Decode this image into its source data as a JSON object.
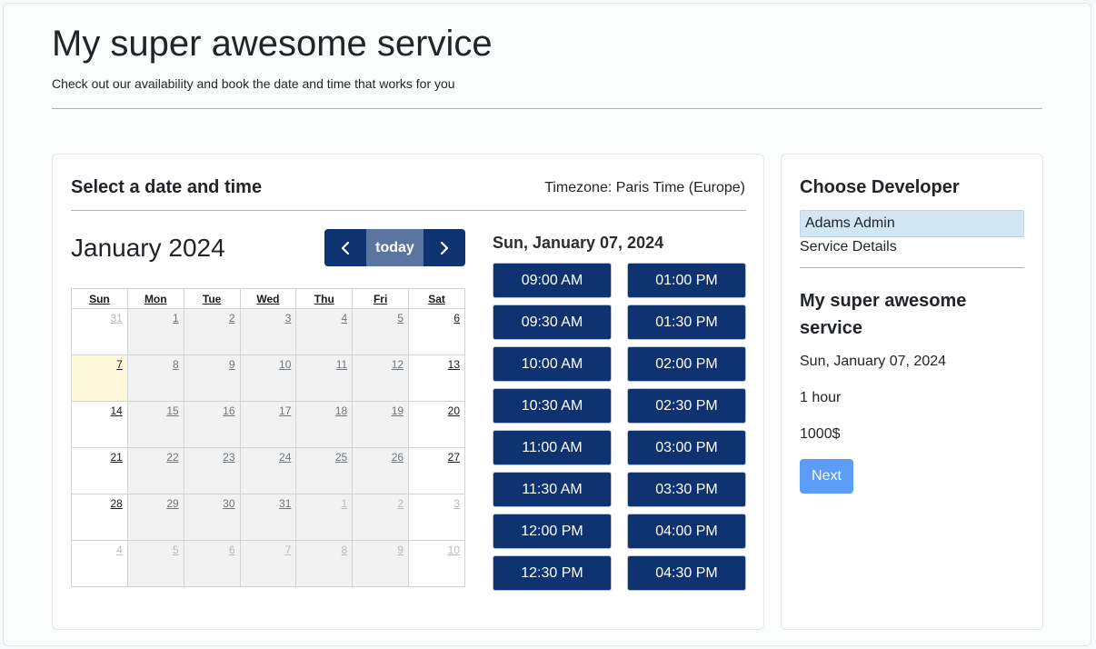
{
  "header": {
    "title": "My super awesome service",
    "subtitle": "Check out our availability and book the date and time that works for you"
  },
  "booking": {
    "heading": "Select a date and time",
    "timezone": "Timezone: Paris Time (Europe)",
    "calendar": {
      "month_title": "January 2024",
      "today_label": "today",
      "prev_icon": "chevron-left-icon",
      "next_icon": "chevron-right-icon",
      "weekdays": [
        "Sun",
        "Mon",
        "Tue",
        "Wed",
        "Thu",
        "Fri",
        "Sat"
      ],
      "weeks": [
        [
          "31",
          "1",
          "2",
          "3",
          "4",
          "5",
          "6"
        ],
        [
          "7",
          "8",
          "9",
          "10",
          "11",
          "12",
          "13"
        ],
        [
          "14",
          "15",
          "16",
          "17",
          "18",
          "19",
          "20"
        ],
        [
          "21",
          "22",
          "23",
          "24",
          "25",
          "26",
          "27"
        ],
        [
          "28",
          "29",
          "30",
          "31",
          "1",
          "2",
          "3"
        ],
        [
          "4",
          "5",
          "6",
          "7",
          "8",
          "9",
          "10"
        ]
      ]
    },
    "selected_date": "Sun, January 07, 2024",
    "time_slots": [
      "09:00 AM",
      "01:00 PM",
      "09:30 AM",
      "01:30 PM",
      "10:00 AM",
      "02:00 PM",
      "10:30 AM",
      "02:30 PM",
      "11:00 AM",
      "03:00 PM",
      "11:30 AM",
      "03:30 PM",
      "12:00 PM",
      "04:00 PM",
      "12:30 PM",
      "04:30 PM"
    ]
  },
  "sidebar": {
    "heading": "Choose Developer",
    "developer": "Adams Admin",
    "service_details_label": "Service Details",
    "service_name": "My super awesome service",
    "date": "Sun, January 07, 2024",
    "duration": "1 hour",
    "price": "1000$",
    "next_label": "Next"
  },
  "colors": {
    "primary": "#0e3370",
    "today_button": "#5a76a0",
    "next_button": "#5a9cf8",
    "selected_day": "#fff9dc",
    "developer_highlight": "#d3e6f3"
  }
}
